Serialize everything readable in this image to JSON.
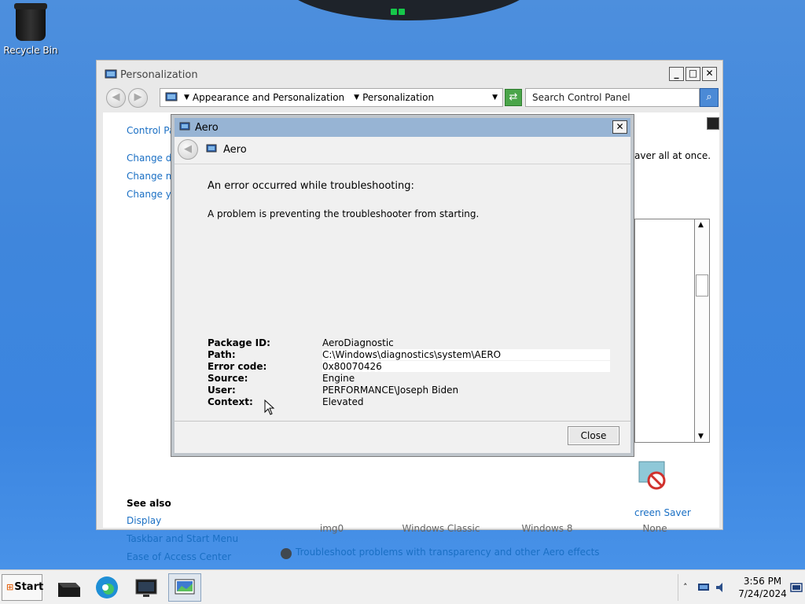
{
  "desktop": {
    "recycle_bin_label": "Recycle Bin"
  },
  "window": {
    "title": "Personalization",
    "minimize": "_",
    "maximize": "□",
    "close": "✕",
    "breadcrumbs": [
      "Appearance and Personalization",
      "Personalization"
    ],
    "search_placeholder": "Search Control Panel",
    "sidebar_links": [
      "Control Pa",
      "Change de",
      "Change m",
      "Change yo"
    ],
    "see_also_heading": "See also",
    "see_also_links": [
      "Display",
      "Taskbar and Start Menu",
      "Ease of Access Center"
    ],
    "right_text": "aver all at once.",
    "themes": [
      "img0",
      "Windows Classic",
      "Windows 8",
      "None"
    ],
    "screen_saver_label": "creen Saver",
    "troubleshoot_link": "Troubleshoot problems with transparency and other Aero effects"
  },
  "dialog": {
    "title": "Aero",
    "nav_label": "Aero",
    "close_x": "✕",
    "heading": "An error occurred while troubleshooting:",
    "message": "A problem is preventing the troubleshooter from starting.",
    "details": [
      {
        "key": "Package ID:",
        "value": "AeroDiagnostic"
      },
      {
        "key": "Path:",
        "value": "C:\\Windows\\diagnostics\\system\\AERO"
      },
      {
        "key": "Error code:",
        "value": "0x80070426"
      },
      {
        "key": "Source:",
        "value": "Engine"
      },
      {
        "key": "User:",
        "value": "PERFORMANCE\\Joseph Biden"
      },
      {
        "key": "Context:",
        "value": "Elevated"
      }
    ],
    "close_button": "Close"
  },
  "taskbar": {
    "start_label": "Start",
    "items": [
      "terminal-app",
      "edge-browser",
      "remote-desktop",
      "personalization-window"
    ],
    "time": "3:56 PM",
    "date": "7/24/2024"
  }
}
